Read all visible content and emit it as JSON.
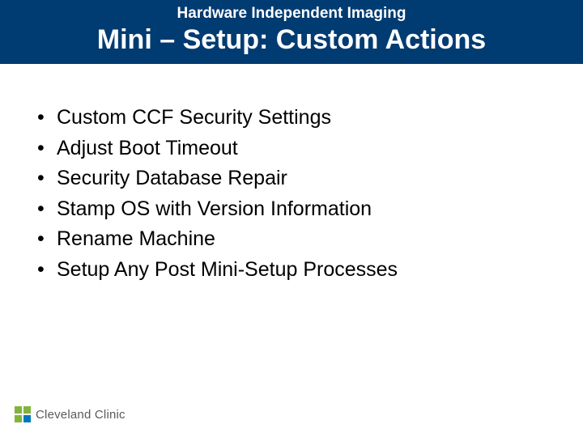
{
  "header": {
    "subtitle": "Hardware Independent Imaging",
    "title": "Mini – Setup: Custom  Actions"
  },
  "bullets": [
    "Custom CCF Security Settings",
    "Adjust Boot Timeout",
    "Security Database Repair",
    "Stamp OS with Version Information",
    "Rename Machine",
    "Setup Any Post Mini-Setup Processes"
  ],
  "footer": {
    "org": "Cleveland Clinic"
  }
}
